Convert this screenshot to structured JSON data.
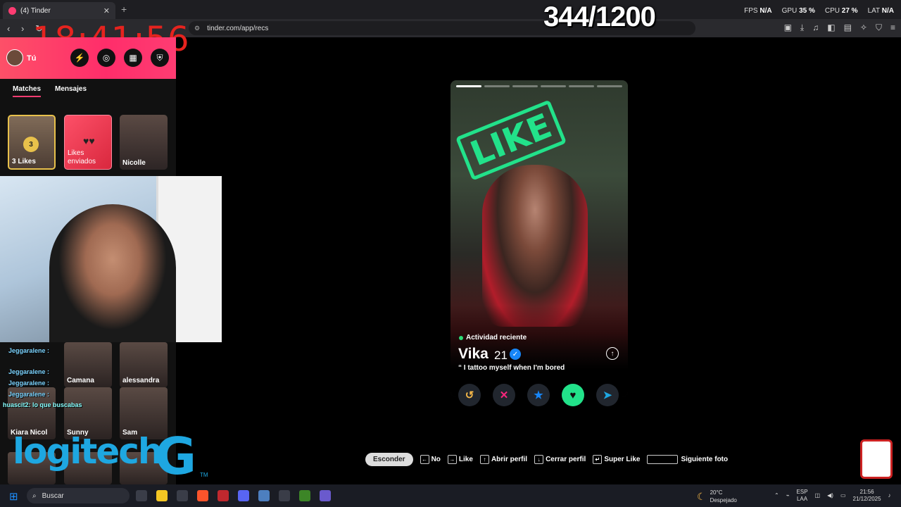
{
  "browser": {
    "tab_title": "(4) Tinder",
    "url": "tinder.com/app/recs",
    "new_tab": "+",
    "close": "✕"
  },
  "overlay": {
    "counter": "344/1200",
    "clock": "18:41:56",
    "stats": [
      {
        "label": "FPS",
        "value": "N/A"
      },
      {
        "label": "GPU",
        "value": "35 %"
      },
      {
        "label": "CPU",
        "value": "27 %"
      },
      {
        "label": "LAT",
        "value": "N/A"
      }
    ]
  },
  "sidebar": {
    "user_label": "Tú",
    "tabs": [
      "Matches",
      "Mensajes"
    ],
    "likes_count": "3",
    "likes_label": "3 Likes",
    "sent_label": "Likes enviados",
    "top_match": "Nicolle",
    "grid": [
      "Camana",
      "alessandra",
      "Kiara Nicol",
      "Sunny",
      "Sam"
    ],
    "chat": [
      "Jeggaralene :",
      "Jeggaralene :",
      "Jeggaralene :",
      "Jeggaralene :",
      "huascit2: lo que buscabas"
    ],
    "logo": "logitech",
    "logo_g": "G",
    "logo_tm": "TM"
  },
  "profile": {
    "stamp": "LIKE",
    "activity": "Actividad reciente",
    "name": "Vika",
    "age": "21",
    "quote": "“ I tattoo myself when I'm bored",
    "photo_count": 6,
    "current_photo": 1
  },
  "shortcuts": {
    "hide": "Esconder",
    "no": "No",
    "like": "Like",
    "open": "Abrir perfil",
    "close": "Cerrar perfil",
    "super": "Super Like",
    "next": "Siguiente foto"
  },
  "taskbar": {
    "search": "Buscar",
    "temp": "20°C",
    "weather": "Despejado",
    "lang1": "ESP",
    "lang2": "LAA",
    "time": "21:56",
    "date": "21/12/2025"
  },
  "colors": {
    "brand": "#fe3c72",
    "like": "#22e28a",
    "super": "#1786f8",
    "nope": "#fd267d",
    "rewind": "#f5b748"
  }
}
